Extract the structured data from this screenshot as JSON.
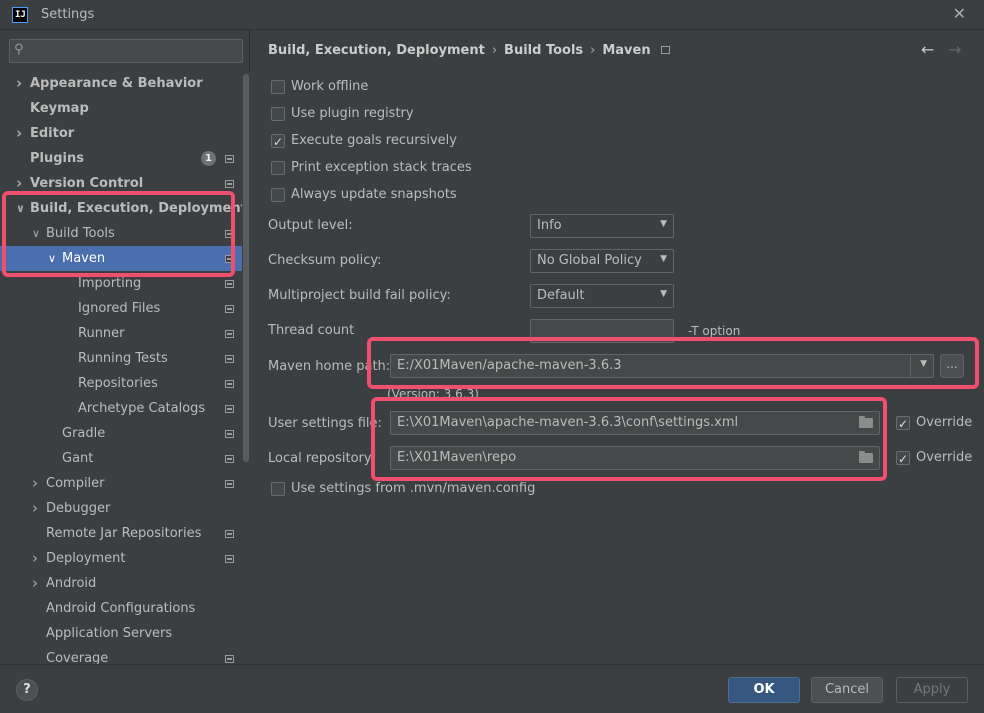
{
  "window": {
    "title": "Settings",
    "app_icon_text": "IJ"
  },
  "search": {
    "placeholder": ""
  },
  "tree": [
    {
      "label": "Appearance & Behavior",
      "level": 0,
      "bold": true,
      "arrow": "right"
    },
    {
      "label": "Keymap",
      "level": 0,
      "bold": true,
      "arrow": ""
    },
    {
      "label": "Editor",
      "level": 0,
      "bold": true,
      "arrow": "right"
    },
    {
      "label": "Plugins",
      "level": 0,
      "bold": true,
      "arrow": "",
      "badge": "1",
      "proj": true
    },
    {
      "label": "Version Control",
      "level": 0,
      "bold": true,
      "arrow": "right",
      "proj": true
    },
    {
      "label": "Build, Execution, Deployment",
      "level": 0,
      "bold": true,
      "arrow": "down"
    },
    {
      "label": "Build Tools",
      "level": 1,
      "arrow": "down",
      "proj": true
    },
    {
      "label": "Maven",
      "level": 2,
      "arrow": "down",
      "selected": true,
      "proj": true
    },
    {
      "label": "Importing",
      "level": 3,
      "arrow": "",
      "proj": true
    },
    {
      "label": "Ignored Files",
      "level": 3,
      "arrow": "",
      "proj": true
    },
    {
      "label": "Runner",
      "level": 3,
      "arrow": "",
      "proj": true
    },
    {
      "label": "Running Tests",
      "level": 3,
      "arrow": "",
      "proj": true
    },
    {
      "label": "Repositories",
      "level": 3,
      "arrow": "",
      "proj": true
    },
    {
      "label": "Archetype Catalogs",
      "level": 3,
      "arrow": "",
      "proj": true
    },
    {
      "label": "Gradle",
      "level": 2,
      "arrow": "",
      "proj": true
    },
    {
      "label": "Gant",
      "level": 2,
      "arrow": "",
      "proj": true
    },
    {
      "label": "Compiler",
      "level": 1,
      "arrow": "right",
      "proj": true
    },
    {
      "label": "Debugger",
      "level": 1,
      "arrow": "right"
    },
    {
      "label": "Remote Jar Repositories",
      "level": 1,
      "arrow": "",
      "proj": true
    },
    {
      "label": "Deployment",
      "level": 1,
      "arrow": "right",
      "proj": true
    },
    {
      "label": "Android",
      "level": 1,
      "arrow": "right"
    },
    {
      "label": "Android Configurations",
      "level": 1,
      "arrow": ""
    },
    {
      "label": "Application Servers",
      "level": 1,
      "arrow": ""
    },
    {
      "label": "Coverage",
      "level": 1,
      "arrow": "",
      "proj": true
    }
  ],
  "breadcrumb": {
    "items": [
      "Build, Execution, Deployment",
      "Build Tools",
      "Maven"
    ],
    "separator": "›"
  },
  "nav": {
    "back": "←",
    "forward": "→"
  },
  "checkboxes": [
    {
      "label": "Work offline",
      "checked": false
    },
    {
      "label": "Use plugin registry",
      "checked": false
    },
    {
      "label": "Execute goals recursively",
      "checked": true
    },
    {
      "label": "Print exception stack traces",
      "checked": false
    },
    {
      "label": "Always update snapshots",
      "checked": false
    }
  ],
  "output_level": {
    "label": "Output level:",
    "value": "Info"
  },
  "checksum_policy": {
    "label": "Checksum policy:",
    "value": "No Global Policy"
  },
  "fail_policy": {
    "label": "Multiproject build fail policy:",
    "value": "Default"
  },
  "thread_count": {
    "label": "Thread count",
    "value": "",
    "hint": "-T option"
  },
  "maven_home": {
    "label": "Maven home path:",
    "value": "E:/X01Maven/apache-maven-3.6.3",
    "browse": "...",
    "version": "(Version: 3.6.3)"
  },
  "user_settings": {
    "label": "User settings file:",
    "value": "E:\\X01Maven\\apache-maven-3.6.3\\conf\\settings.xml",
    "override_label": "Override",
    "override": true
  },
  "local_repo": {
    "label": "Local repository:",
    "value": "E:\\X01Maven\\repo",
    "override_label": "Override",
    "override": true
  },
  "mvn_config": {
    "label": "Use settings from .mvn/maven.config",
    "checked": false
  },
  "footer": {
    "help": "?",
    "ok": "OK",
    "cancel": "Cancel",
    "apply": "Apply"
  },
  "colors": {
    "background": "#3c3f41",
    "selection": "#4b6eaf",
    "highlight": "#f0506e",
    "ok_button": "#365880"
  }
}
